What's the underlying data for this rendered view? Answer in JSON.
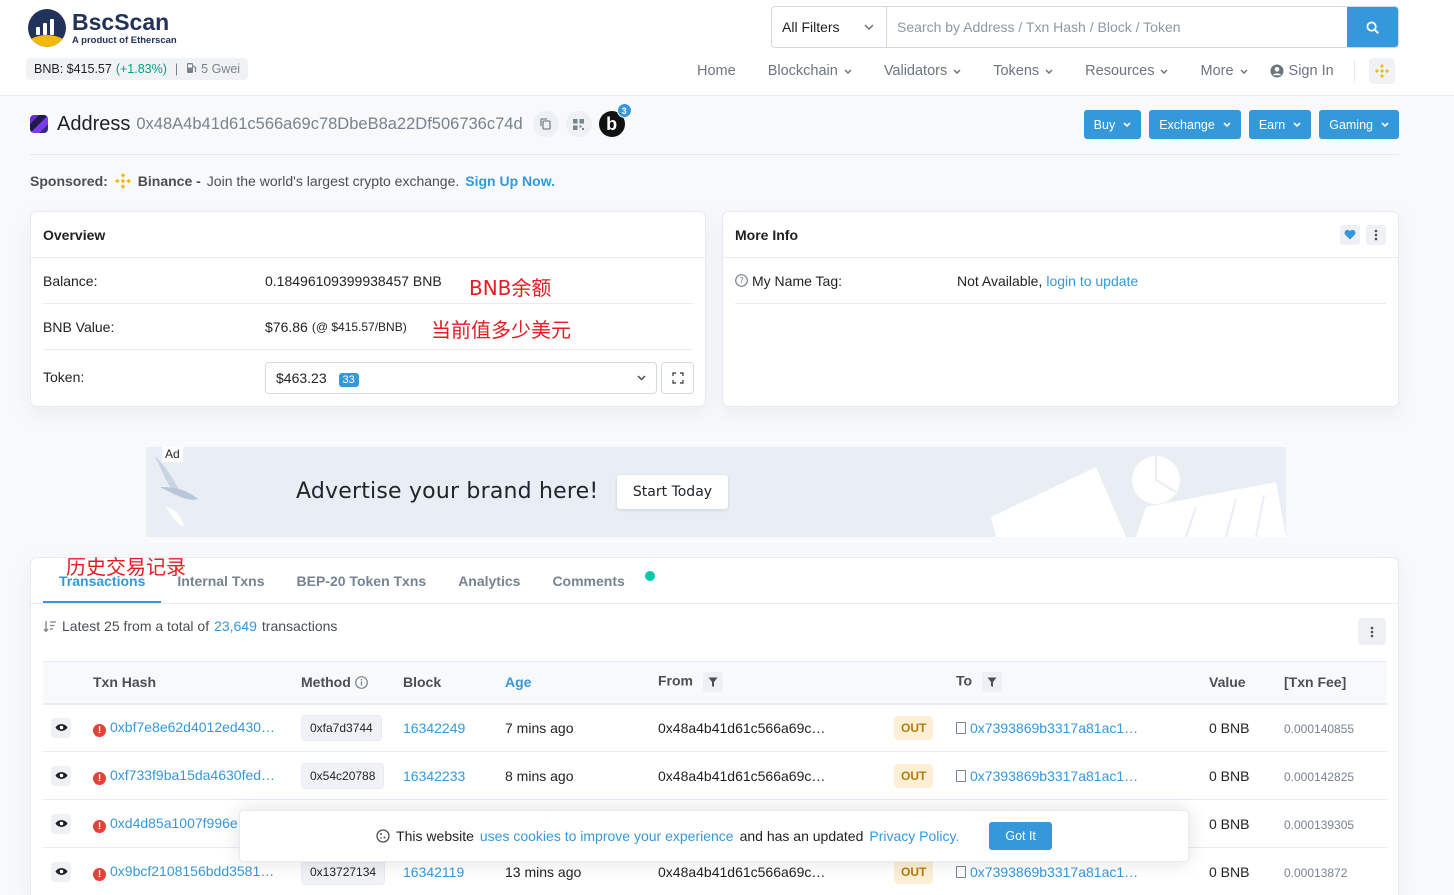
{
  "brand": {
    "name": "BscScan",
    "tagline": "A product of Etherscan",
    "price_label": "BNB: $415.57",
    "price_change": "(+1.83%)",
    "separator": "|",
    "gas": "5 Gwei"
  },
  "search": {
    "filter_label": "All Filters",
    "placeholder": "Search by Address / Txn Hash / Block / Token"
  },
  "nav": {
    "items": [
      {
        "label": "Home",
        "dropdown": false
      },
      {
        "label": "Blockchain",
        "dropdown": true
      },
      {
        "label": "Validators",
        "dropdown": true
      },
      {
        "label": "Tokens",
        "dropdown": true
      },
      {
        "label": "Resources",
        "dropdown": true
      },
      {
        "label": "More",
        "dropdown": true
      }
    ],
    "signin": "Sign In"
  },
  "address": {
    "label": "Address",
    "hash": "0x48A4b41d61c566a69c78DbeB8a22Df506736c74d",
    "badge_letter": "b",
    "badge_count": "3"
  },
  "actions": [
    "Buy",
    "Exchange",
    "Earn",
    "Gaming"
  ],
  "sponsored": {
    "label": "Sponsored:",
    "brand": "Binance -",
    "text": "Join the world's largest crypto exchange.",
    "link": "Sign Up Now."
  },
  "overview": {
    "title": "Overview",
    "balance_label": "Balance:",
    "balance_value": "0.18496109399938457 BNB",
    "value_label": "BNB Value:",
    "value_amount": "$76.86",
    "value_rate": "(@ $415.57/BNB)",
    "token_label": "Token:",
    "token_value": "$463.23",
    "token_count": "33"
  },
  "annotations": {
    "balance": "BNB余额",
    "value": "当前值多少美元",
    "history": "历史交易记录"
  },
  "more_info": {
    "title": "More Info",
    "name_tag_label": "My Name Tag:",
    "name_tag_value": "Not Available,",
    "name_tag_link": "login to update"
  },
  "ad": {
    "label": "Ad",
    "text": "Advertise your brand here!",
    "button": "Start Today"
  },
  "tabs": [
    {
      "label": "Transactions",
      "active": true
    },
    {
      "label": "Internal Txns",
      "active": false
    },
    {
      "label": "BEP-20 Token Txns",
      "active": false
    },
    {
      "label": "Analytics",
      "active": false
    },
    {
      "label": "Comments",
      "active": false
    }
  ],
  "summary": {
    "prefix": "Latest 25 from a total of",
    "count": "23,649",
    "suffix": "transactions"
  },
  "table": {
    "headers": {
      "txn_hash": "Txn Hash",
      "method": "Method",
      "block": "Block",
      "age": "Age",
      "from": "From",
      "to": "To",
      "value": "Value",
      "fee": "[Txn Fee]"
    },
    "rows": [
      {
        "hash": "0xbf7e8e62d4012ed430…",
        "method": "0xfa7d3744",
        "block": "16342249",
        "age": "7 mins ago",
        "from": "0x48a4b41d61c566a69c…",
        "dir": "OUT",
        "to": "0x7393869b3317a81ac1…",
        "value": "0 BNB",
        "fee": "0.000140855"
      },
      {
        "hash": "0xf733f9ba15da4630fed…",
        "method": "0x54c20788",
        "block": "16342233",
        "age": "8 mins ago",
        "from": "0x48a4b41d61c566a69c…",
        "dir": "OUT",
        "to": "0x7393869b3317a81ac1…",
        "value": "0 BNB",
        "fee": "0.000142825"
      },
      {
        "hash": "0xd4d85a1007f996e",
        "method": "",
        "block": "",
        "age": "",
        "from": "",
        "dir": "",
        "to": "",
        "value": "0 BNB",
        "fee": "0.000139305"
      },
      {
        "hash": "0x9bcf2108156bdd3581…",
        "method": "0x13727134",
        "block": "16342119",
        "age": "13 mins ago",
        "from": "0x48a4b41d61c566a69c…",
        "dir": "OUT",
        "to": "0x7393869b3317a81ac1…",
        "value": "0 BNB",
        "fee": "0.00013872"
      }
    ]
  },
  "cookie": {
    "text1": "This website",
    "link1": "uses cookies to improve your experience",
    "text2": "and has an updated",
    "link2": "Privacy Policy.",
    "button": "Got It"
  },
  "colors": {
    "accent": "#3498db",
    "bnb": "#f0b90b",
    "error": "#de4437",
    "annotation": "#e51c23"
  }
}
